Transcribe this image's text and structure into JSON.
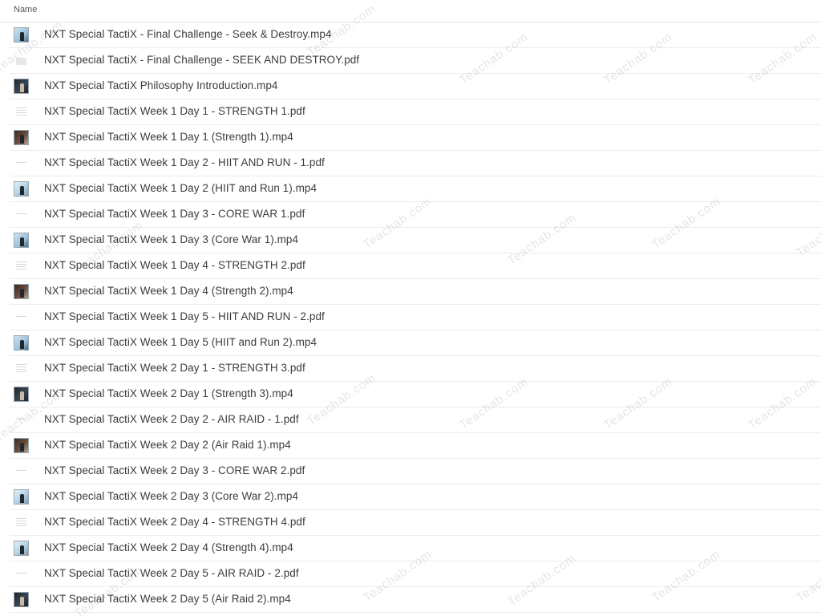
{
  "header": {
    "name_column_label": "Name"
  },
  "files": [
    {
      "name": "NXT Special TactiX - Final Challenge - Seek & Destroy.mp4",
      "type": "video",
      "thumb": "light",
      "icon": "video-thumbnail-icon"
    },
    {
      "name": "NXT Special TactiX - Final Challenge - SEEK AND DESTROY.pdf",
      "type": "pdf",
      "thumb": "folder",
      "icon": "pdf-thumbnail-icon"
    },
    {
      "name": "NXT Special TactiX Philosophy Introduction.mp4",
      "type": "video",
      "thumb": "dark",
      "icon": "video-thumbnail-icon"
    },
    {
      "name": "NXT Special TactiX Week 1 Day 1 - STRENGTH 1.pdf",
      "type": "pdf",
      "thumb": "lines",
      "icon": "pdf-thumbnail-icon"
    },
    {
      "name": "NXT Special TactiX Week 1 Day 1 (Strength 1).mp4",
      "type": "video",
      "thumb": "warm",
      "icon": "video-thumbnail-icon"
    },
    {
      "name": "NXT Special TactiX Week 1 Day 2 - HIIT AND RUN - 1.pdf",
      "type": "pdf",
      "thumb": "sparse",
      "icon": "pdf-thumbnail-icon"
    },
    {
      "name": "NXT Special TactiX Week 1 Day 2 (HIIT and Run 1).mp4",
      "type": "video",
      "thumb": "bright",
      "icon": "video-thumbnail-icon"
    },
    {
      "name": "NXT Special TactiX Week 1 Day 3 - CORE WAR 1.pdf",
      "type": "pdf",
      "thumb": "sparse",
      "icon": "pdf-thumbnail-icon"
    },
    {
      "name": "NXT Special TactiX Week 1 Day 3 (Core War 1).mp4",
      "type": "video",
      "thumb": "light",
      "icon": "video-thumbnail-icon"
    },
    {
      "name": "NXT Special TactiX Week 1 Day 4 - STRENGTH 2.pdf",
      "type": "pdf",
      "thumb": "lines",
      "icon": "pdf-thumbnail-icon"
    },
    {
      "name": "NXT Special TactiX Week 1 Day 4 (Strength 2).mp4",
      "type": "video",
      "thumb": "warm",
      "icon": "video-thumbnail-icon"
    },
    {
      "name": "NXT Special TactiX Week 1 Day 5 - HIIT AND RUN - 2.pdf",
      "type": "pdf",
      "thumb": "sparse",
      "icon": "pdf-thumbnail-icon"
    },
    {
      "name": "NXT Special TactiX Week 1 Day 5 (HIIT and Run 2).mp4",
      "type": "video",
      "thumb": "light",
      "icon": "video-thumbnail-icon"
    },
    {
      "name": "NXT Special TactiX Week 2 Day 1 - STRENGTH 3.pdf",
      "type": "pdf",
      "thumb": "lines",
      "icon": "pdf-thumbnail-icon"
    },
    {
      "name": "NXT Special TactiX Week 2 Day 1 (Strength 3).mp4",
      "type": "video",
      "thumb": "dark",
      "icon": "video-thumbnail-icon"
    },
    {
      "name": "NXT Special TactiX Week 2 Day 2 - AIR RAID - 1.pdf",
      "type": "pdf",
      "thumb": "sparse",
      "icon": "pdf-thumbnail-icon"
    },
    {
      "name": "NXT Special TactiX Week 2 Day 2 (Air Raid 1).mp4",
      "type": "video",
      "thumb": "warm",
      "icon": "video-thumbnail-icon"
    },
    {
      "name": "NXT Special TactiX Week 2 Day 3 - CORE WAR 2.pdf",
      "type": "pdf",
      "thumb": "sparse",
      "icon": "pdf-thumbnail-icon"
    },
    {
      "name": "NXT Special TactiX Week 2 Day 3 (Core War 2).mp4",
      "type": "video",
      "thumb": "bright",
      "icon": "video-thumbnail-icon"
    },
    {
      "name": "NXT Special TactiX Week 2 Day 4 - STRENGTH 4.pdf",
      "type": "pdf",
      "thumb": "lines",
      "icon": "pdf-thumbnail-icon"
    },
    {
      "name": "NXT Special TactiX Week 2 Day 4 (Strength 4).mp4",
      "type": "video",
      "thumb": "bright",
      "icon": "video-thumbnail-icon"
    },
    {
      "name": "NXT Special TactiX Week 2 Day 5 - AIR RAID - 2.pdf",
      "type": "pdf",
      "thumb": "sparse",
      "icon": "pdf-thumbnail-icon"
    },
    {
      "name": "NXT Special TactiX Week 2 Day 5 (Air Raid 2).mp4",
      "type": "video",
      "thumb": "dark",
      "icon": "video-thumbnail-icon"
    }
  ],
  "watermark": {
    "text": "Teachab.com",
    "color": "#a0a0a0"
  }
}
